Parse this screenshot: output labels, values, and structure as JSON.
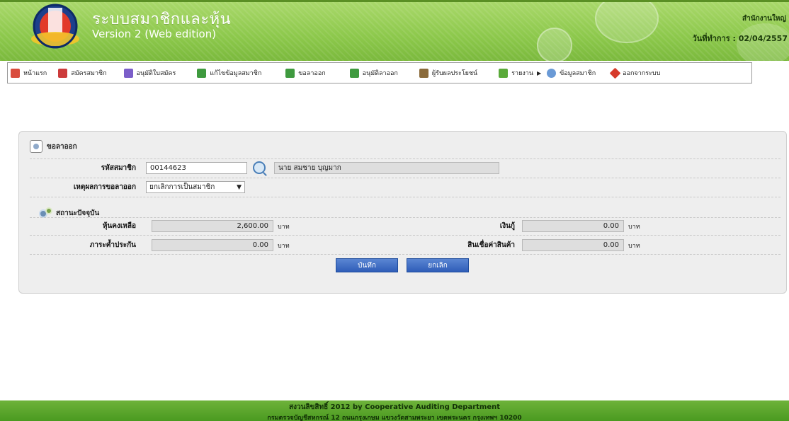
{
  "header": {
    "app_title": "ระบบสมาชิกและหุ้น",
    "app_subtitle": "Version 2 (Web edition)",
    "branch": "สำนักงานใหญ่",
    "work_date": "วันที่ทำการ : 02/04/2557"
  },
  "menu": [
    {
      "label": "หน้าแรก",
      "icon": "home-icon",
      "color": "#d94c3d"
    },
    {
      "label": "สมัครสมาชิก",
      "icon": "register-icon",
      "color": "#cc3b3b"
    },
    {
      "label": "อนุมัติใบสมัคร",
      "icon": "approve-icon",
      "color": "#7b5ec9"
    },
    {
      "label": "แก้ไขข้อมูลสมาชิก",
      "icon": "edit-icon",
      "color": "#3f9a3f"
    },
    {
      "label": "ขอลาออก",
      "icon": "resign-request-icon",
      "color": "#3f9a3f"
    },
    {
      "label": "อนุมัติลาออก",
      "icon": "approve-resign-icon",
      "color": "#3f9a3f"
    },
    {
      "label": "ผู้รับผลประโยชน์",
      "icon": "beneficiary-icon",
      "color": "#8a6a3a"
    },
    {
      "label": "รายงาน",
      "icon": "report-icon",
      "color": "#5aaa3a",
      "submenu": true
    },
    {
      "label": "ข้อมูลสมาชิก",
      "icon": "member-info-icon",
      "color": "#6a9ad6"
    },
    {
      "label": "ออกจากระบบ",
      "icon": "logout-icon",
      "color": "#d63a2a"
    }
  ],
  "form": {
    "title": "ขอลาออก",
    "member_id_label": "รหัสสมาชิก",
    "member_id_value": "00144623",
    "member_name": "นาย สมชาย บุญมาก",
    "reason_label": "เหตุผลการขอลาออก",
    "reason_value": "ยกเลิกการเป็นสมาชิก",
    "status_title": "สถานะปัจจุบัน",
    "shares_label": "หุ้นคงเหลือ",
    "shares_value": "2,600.00",
    "loan_label": "เงินกู้",
    "loan_value": "0.00",
    "guarantee_label": "ภาระค้ำประกัน",
    "guarantee_value": "0.00",
    "credit_label": "สินเชื่อค่าสินค้า",
    "credit_value": "0.00",
    "unit": "บาท",
    "save_label": "บันทึก",
    "cancel_label": "ยกเลิก"
  },
  "footer": {
    "line1": "สงวนลิขสิทธิ์ 2012 by Cooperative Auditing Department",
    "line2": "กรมตรวจบัญชีสหกรณ์ 12 ถนนกรุงเกษม แขวงวัดสามพระยา เขตพระนคร กรุงเทพฯ 10200"
  }
}
